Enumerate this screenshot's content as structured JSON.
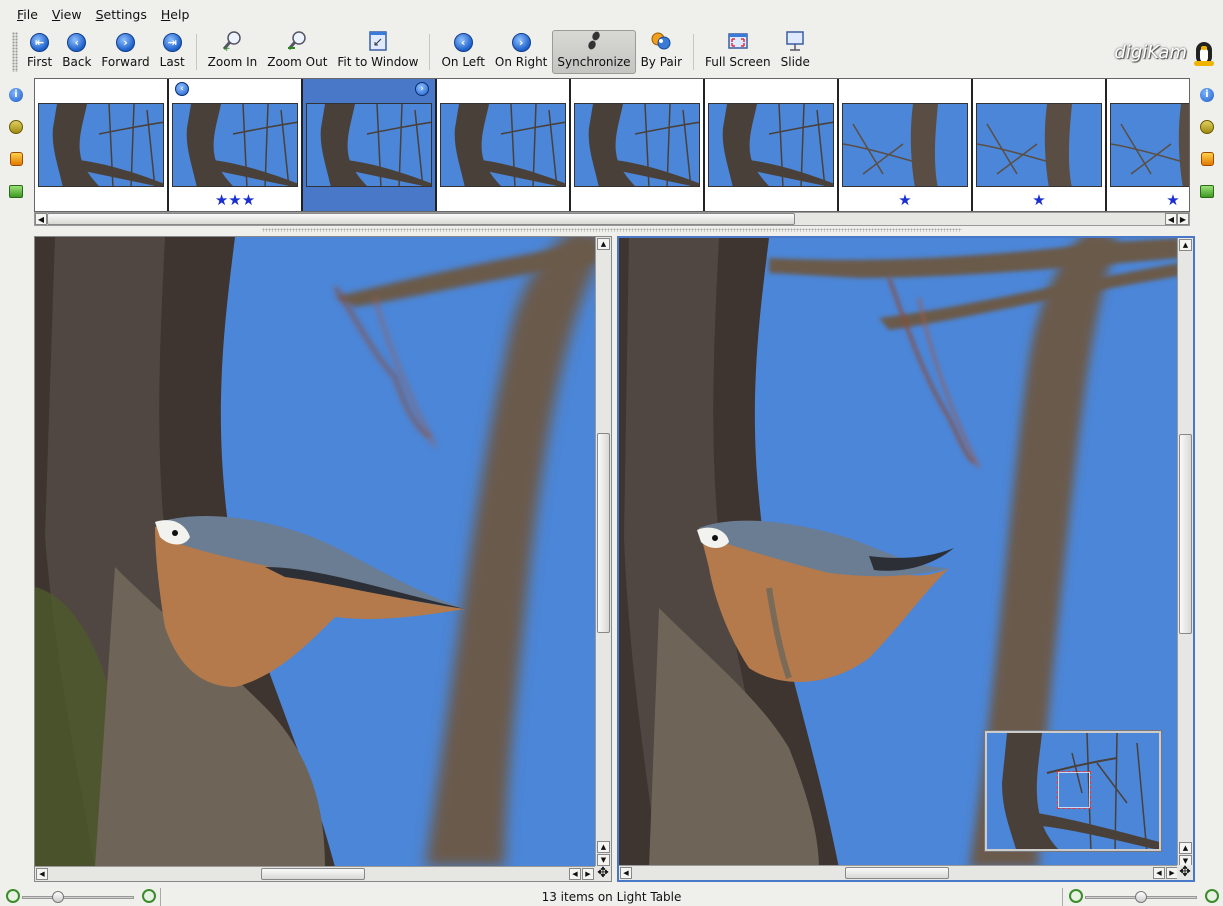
{
  "menu": [
    {
      "accel": "F",
      "rest": "ile"
    },
    {
      "accel": "V",
      "rest": "iew"
    },
    {
      "accel": "S",
      "rest": "ettings"
    },
    {
      "accel": "H",
      "rest": "elp"
    }
  ],
  "toolbar": {
    "first": "First",
    "back": "Back",
    "forward": "Forward",
    "last": "Last",
    "zoom_in": "Zoom In",
    "zoom_out": "Zoom Out",
    "fit_to_window": "Fit to Window",
    "on_left": "On Left",
    "on_right": "On Right",
    "synchronize": "Synchronize",
    "by_pair": "By Pair",
    "full_screen": "Full Screen",
    "slide": "Slide"
  },
  "logo_text": "digiKam",
  "thumbnails": [
    {
      "stars": "",
      "badge": "",
      "selected": false
    },
    {
      "stars": "★★★",
      "badge": "left",
      "selected": false
    },
    {
      "stars": "",
      "badge": "right",
      "selected": true
    },
    {
      "stars": "",
      "badge": "",
      "selected": false
    },
    {
      "stars": "",
      "badge": "",
      "selected": false
    },
    {
      "stars": "",
      "badge": "",
      "selected": false
    },
    {
      "stars": "★",
      "badge": "",
      "selected": false
    },
    {
      "stars": "★",
      "badge": "",
      "selected": false
    },
    {
      "stars": "★",
      "badge": "",
      "selected": false
    }
  ],
  "status": {
    "text": "13 items on Light Table"
  },
  "zoom": {
    "left_level": 0.3,
    "right_level": 0.5
  },
  "colors": {
    "accent": "#4a78c8",
    "sky": "#4b86d8",
    "star": "#1a2fd0"
  }
}
